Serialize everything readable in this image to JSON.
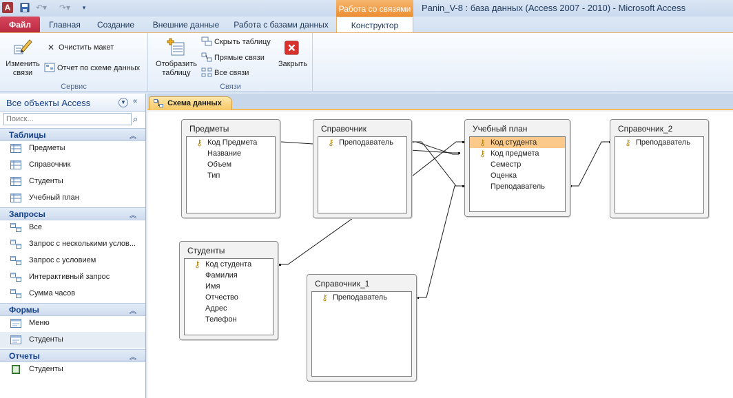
{
  "window": {
    "app_icon": "A",
    "title": "Panin_V-8 : база данных (Access 2007 - 2010)  -  Microsoft Access",
    "contextual_group": "Работа со связями"
  },
  "tabs": {
    "file": "Файл",
    "home": "Главная",
    "create": "Создание",
    "external": "Внешние данные",
    "dbtools": "Работа с базами данных",
    "design": "Конструктор"
  },
  "ribbon": {
    "service": {
      "label": "Сервис",
      "edit_relations": "Изменить связи",
      "clear_layout": "Очистить макет",
      "relationship_report": "Отчет по схеме данных"
    },
    "relations": {
      "label": "Связи",
      "show_table": "Отобразить таблицу",
      "hide_table": "Скрыть таблицу",
      "direct_relations": "Прямые связи",
      "all_relations": "Все связи",
      "close": "Закрыть"
    }
  },
  "nav": {
    "title": "Все объекты Access",
    "search_placeholder": "Поиск...",
    "sections": [
      {
        "label": "Таблицы",
        "items": [
          "Предметы",
          "Справочник",
          "Студенты",
          "Учебный план"
        ]
      },
      {
        "label": "Запросы",
        "items": [
          "Все",
          "Запрос с несколькими услов...",
          "Запрос с условием",
          "Интерактивный запрос",
          "Сумма часов"
        ]
      },
      {
        "label": "Формы",
        "items": [
          "Меню",
          "Студенты"
        ]
      },
      {
        "label": "Отчеты",
        "items": [
          "Студенты"
        ]
      }
    ]
  },
  "document": {
    "tab_label": "Схема данных",
    "tables": [
      {
        "name": "Предметы",
        "fields": [
          "Код Предмета",
          "Название",
          "Объем",
          "Тип"
        ],
        "keys": [
          0
        ]
      },
      {
        "name": "Справочник",
        "fields": [
          "Преподаватель"
        ],
        "keys": [
          0
        ]
      },
      {
        "name": "Учебный план",
        "fields": [
          "Код студента",
          "Код предмета",
          "Семестр",
          "Оценка",
          "Преподаватель"
        ],
        "keys": [
          0,
          1
        ],
        "selected": 0
      },
      {
        "name": "Справочник_2",
        "fields": [
          "Преподаватель"
        ],
        "keys": [
          0
        ]
      },
      {
        "name": "Студенты",
        "fields": [
          "Код студента",
          "Фамилия",
          "Имя",
          "Отчество",
          "Адрес",
          "Телефон"
        ],
        "keys": [
          0
        ]
      },
      {
        "name": "Справочник_1",
        "fields": [
          "Преподаватель"
        ],
        "keys": [
          0
        ]
      }
    ]
  }
}
